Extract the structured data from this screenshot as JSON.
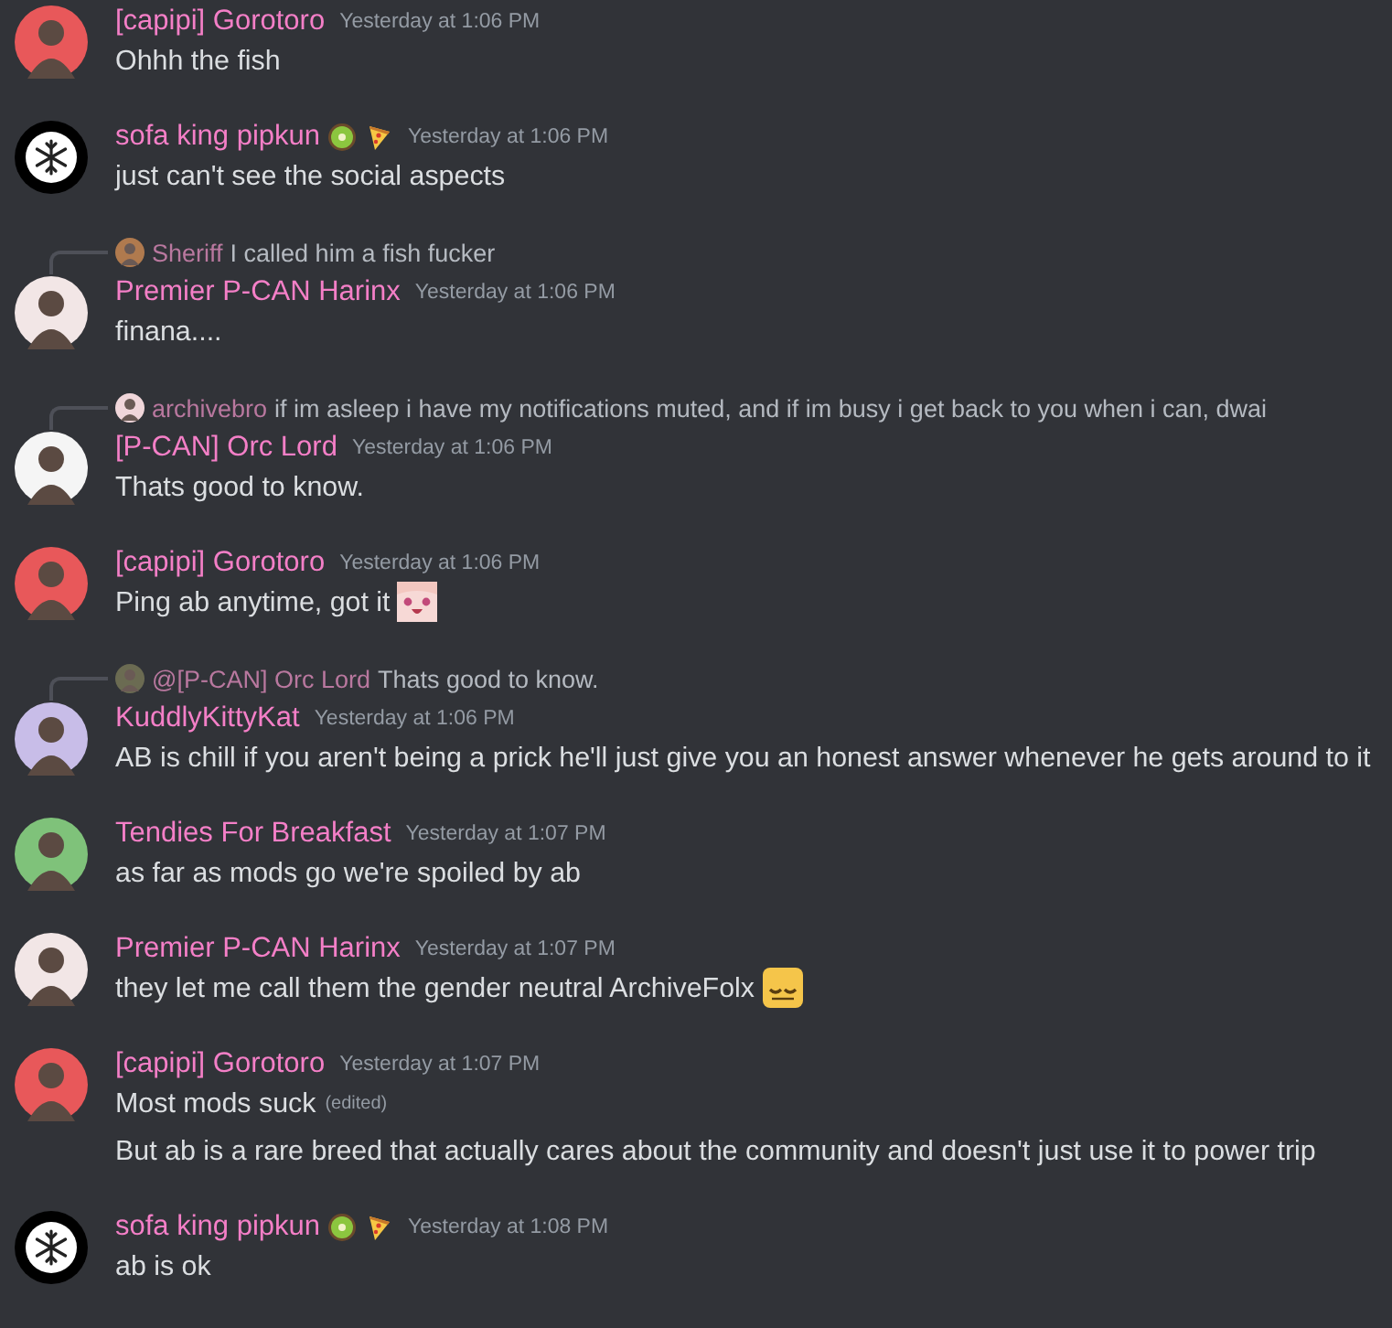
{
  "messages": [
    {
      "author": "[capipi] Gorotoro",
      "avatar": {
        "kind": "figure",
        "color": "#e8585a"
      },
      "timestamp": "Yesterday at 1:06 PM",
      "lines": [
        {
          "text": "Ohhh the fish"
        }
      ]
    },
    {
      "author": "sofa king pipkun",
      "avatar": {
        "kind": "snowflake",
        "color": "#000000"
      },
      "badges": [
        {
          "kind": "kiwi"
        },
        {
          "kind": "pizza"
        }
      ],
      "timestamp": "Yesterday at 1:06 PM",
      "lines": [
        {
          "text": "just can't see the social aspects"
        }
      ]
    },
    {
      "author": "Premier P-CAN Harinx",
      "avatar": {
        "kind": "figure",
        "color": "#f2e6e6"
      },
      "timestamp": "Yesterday at 1:06 PM",
      "reply": {
        "author": "Sheriff",
        "text": "I called him a fish fucker",
        "avatar": {
          "color": "#b07a4e"
        }
      },
      "lines": [
        {
          "text": "finana...."
        }
      ]
    },
    {
      "author": "[P-CAN] Orc Lord",
      "avatar": {
        "kind": "figure",
        "color": "#f5f5f5"
      },
      "timestamp": "Yesterday at 1:06 PM",
      "reply": {
        "author": "archivebro",
        "text": "if im asleep i have my notifications muted, and if im busy i get back to you when i can, dwai",
        "avatar": {
          "color": "#f0d6da"
        }
      },
      "lines": [
        {
          "text": "Thats good to know."
        }
      ]
    },
    {
      "author": "[capipi] Gorotoro",
      "avatar": {
        "kind": "figure",
        "color": "#e8585a"
      },
      "timestamp": "Yesterday at 1:06 PM",
      "lines": [
        {
          "text": "Ping ab anytime, got it",
          "emoji": {
            "kind": "smiling-face"
          }
        }
      ]
    },
    {
      "author": "KuddlyKittyKat",
      "avatar": {
        "kind": "figure",
        "color": "#c8bde8"
      },
      "timestamp": "Yesterday at 1:06 PM",
      "reply": {
        "author": "@[P-CAN] Orc Lord",
        "text": "Thats good to know.",
        "avatar": {
          "color": "#6b6b52"
        }
      },
      "lines": [
        {
          "text": "AB is chill if you aren't being a prick he'll just give you an honest answer whenever he gets around to it"
        }
      ]
    },
    {
      "author": "Tendies For Breakfast",
      "avatar": {
        "kind": "figure",
        "color": "#7fc27a"
      },
      "timestamp": "Yesterday at 1:07 PM",
      "lines": [
        {
          "text": "as far as mods go we're spoiled by ab"
        }
      ]
    },
    {
      "author": "Premier P-CAN Harinx",
      "avatar": {
        "kind": "figure",
        "color": "#f2e6e6"
      },
      "timestamp": "Yesterday at 1:07 PM",
      "lines": [
        {
          "text": "they let me call them the gender neutral ArchiveFolx",
          "emoji": {
            "kind": "sleepy-face"
          }
        }
      ]
    },
    {
      "author": "[capipi] Gorotoro",
      "avatar": {
        "kind": "figure",
        "color": "#e8585a"
      },
      "timestamp": "Yesterday at 1:07 PM",
      "lines": [
        {
          "text": "Most mods suck",
          "edited": "(edited)"
        },
        {
          "text": "But ab is a rare breed that actually cares about the community and doesn't just use it to power trip"
        }
      ]
    },
    {
      "author": "sofa king pipkun",
      "avatar": {
        "kind": "snowflake",
        "color": "#000000"
      },
      "badges": [
        {
          "kind": "kiwi"
        },
        {
          "kind": "pizza"
        }
      ],
      "timestamp": "Yesterday at 1:08 PM",
      "lines": [
        {
          "text": "ab is ok"
        }
      ]
    }
  ]
}
